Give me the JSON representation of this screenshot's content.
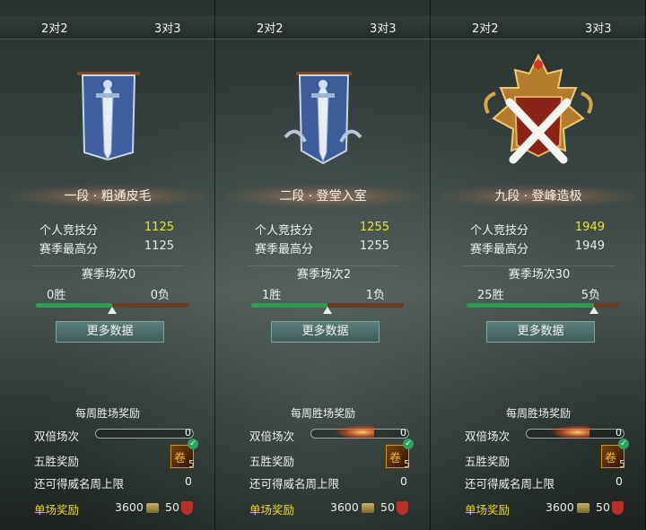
{
  "panels": [
    {
      "tabs": [
        "2对2",
        "3对3"
      ],
      "emblem": "silver-sword-banner-icon",
      "rank_title": "二段 · 登堂入室",
      "personal_score_label": "个人竞技分",
      "personal_score": "1255",
      "season_high_label": "赛季最高分",
      "season_high": "1255",
      "season_matches": "赛季场次2",
      "wins": "1胜",
      "losses": "1负",
      "win_ratio": 0.5,
      "more_button": "更多数据",
      "weekly_title": "每周胜场奖励",
      "double_label": "双倍场次",
      "double_count": "0",
      "double_active": true,
      "five_win_label": "五胜奖励",
      "five_win_count": "5",
      "cap_label": "还可得威名周上限",
      "cap_value": "0",
      "single_reward_label": "单场奖励",
      "single_coins": "3600",
      "single_badge": "50"
    },
    {
      "tabs": [
        "2对2",
        "3对3"
      ],
      "emblem": "gold-crossed-swords-crest-icon",
      "rank_title": "九段 · 登峰造极",
      "personal_score_label": "个人竞技分",
      "personal_score": "1949",
      "season_high_label": "赛季最高分",
      "season_high": "1949",
      "season_matches": "赛季场次30",
      "wins": "25胜",
      "losses": "5负",
      "win_ratio": 0.833,
      "more_button": "更多数据",
      "weekly_title": "每周胜场奖励",
      "double_label": "双倍场次",
      "double_count": "0",
      "double_active": true,
      "five_win_label": "五胜奖励",
      "five_win_count": "5",
      "cap_label": "还可得威名周上限",
      "cap_value": "0",
      "single_reward_label": "单场奖励",
      "single_coins": "3600",
      "single_badge": "50"
    },
    {
      "tabs": [
        "2对2",
        "3对3"
      ],
      "emblem": "silver-sword-banner-icon",
      "rank_title": "一段 · 粗通皮毛",
      "personal_score_label": "个人竞技分",
      "personal_score": "1125",
      "season_high_label": "赛季最高分",
      "season_high": "1125",
      "season_matches": "赛季场次0",
      "wins": "0胜",
      "losses": "0负",
      "win_ratio": 0.5,
      "more_button": "更多数据",
      "weekly_title": "每周胜场奖励",
      "double_label": "双倍场次",
      "double_count": "0",
      "double_active": false,
      "five_win_label": "五胜奖励",
      "five_win_count": "5",
      "cap_label": "还可得威名周上限",
      "cap_value": "0",
      "single_reward_label": "单场奖励",
      "single_coins": "3600",
      "single_badge": "50"
    }
  ],
  "colors": {
    "gold_score": "#f3e21f",
    "reward_label": "#f1d92a",
    "win_bar": "#2f9a57",
    "loss_bar": "#6b3b24",
    "button": "#4d6f6b"
  }
}
